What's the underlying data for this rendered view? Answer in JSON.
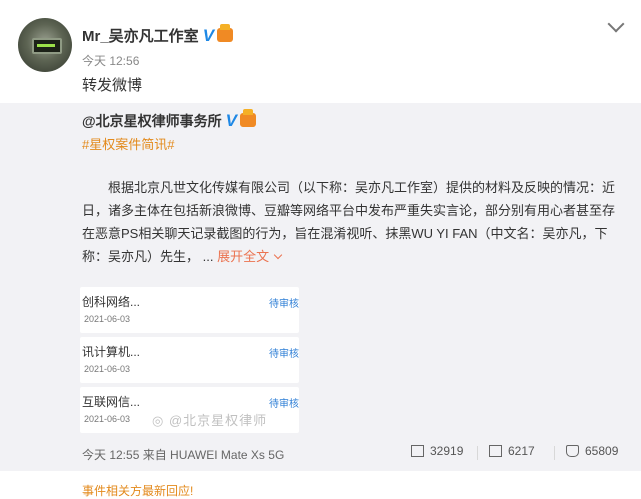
{
  "post": {
    "author": "Mr_吴亦凡工作室",
    "time": "今天 12:56",
    "text": "转发微博"
  },
  "original": {
    "author": "@北京星权律师事务所",
    "tag": "#星权案件简讯#",
    "body": "根据北京凡世文化传媒有限公司（以下称：吴亦凡工作室）提供的材料及反映的情况：近日，诸多主体在包括新浪微博、豆瓣等网络平台中发布严重失实言论，部分别有用心者甚至存在恶意PS相关聊天记录截图的行为，旨在混淆视听、抹黑WU YI FAN（中文名：吴亦凡，下称：吴亦凡）先生，",
    "ellipsis": "...",
    "expand": "展开全文",
    "items": [
      {
        "title": "创科网络...",
        "date": "2021-06-03",
        "status": "待审核"
      },
      {
        "title": "讯计算机...",
        "date": "2021-06-03",
        "status": "待审核"
      },
      {
        "title": "互联网信...",
        "date": "2021-06-03",
        "status": "待审核"
      }
    ],
    "watermark": "@北京星权律师",
    "footer_time": "今天 12:55 来自 HUAWEI Mate Xs 5G",
    "reposts": "32919",
    "comments": "6217",
    "likes": "65809"
  },
  "bottom_hint": "事件相关方最新回应!",
  "colors": {
    "link": "#eb7350",
    "tag": "#e38a1c",
    "status": "#2f7fd6",
    "verified": "#1e88e5"
  },
  "icons": [
    "avatar",
    "verified-v-icon",
    "crown-icon",
    "chevron-down-icon",
    "repost-icon",
    "comment-icon",
    "like-icon",
    "weibo-watermark-icon"
  ]
}
